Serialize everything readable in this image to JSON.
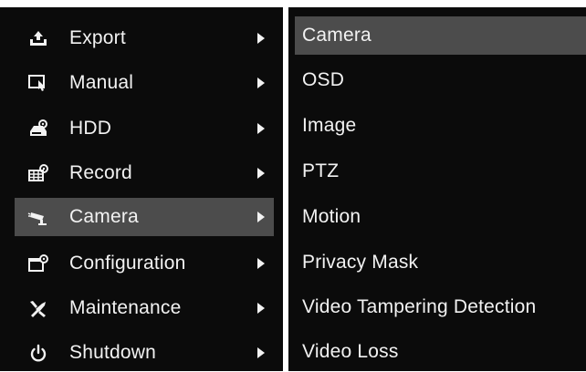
{
  "main_menu": {
    "items": [
      {
        "label": "Export",
        "icon": "export-icon",
        "selected": false
      },
      {
        "label": "Manual",
        "icon": "manual-icon",
        "selected": false
      },
      {
        "label": "HDD",
        "icon": "hdd-icon",
        "selected": false
      },
      {
        "label": "Record",
        "icon": "record-icon",
        "selected": false
      },
      {
        "label": "Camera",
        "icon": "camera-icon",
        "selected": true
      },
      {
        "label": "Configuration",
        "icon": "configuration-icon",
        "selected": false
      },
      {
        "label": "Maintenance",
        "icon": "maintenance-icon",
        "selected": false
      },
      {
        "label": "Shutdown",
        "icon": "power-icon",
        "selected": false
      }
    ]
  },
  "sub_menu": {
    "items": [
      {
        "label": "Camera",
        "selected": true
      },
      {
        "label": "OSD",
        "selected": false
      },
      {
        "label": "Image",
        "selected": false
      },
      {
        "label": "PTZ",
        "selected": false
      },
      {
        "label": "Motion",
        "selected": false
      },
      {
        "label": "Privacy Mask",
        "selected": false
      },
      {
        "label": "Video Tampering Detection",
        "selected": false
      },
      {
        "label": "Video Loss",
        "selected": false
      }
    ]
  },
  "colors": {
    "background": "#0b0b0b",
    "highlight": "#4c4c4c",
    "text": "#f2f2f2"
  }
}
